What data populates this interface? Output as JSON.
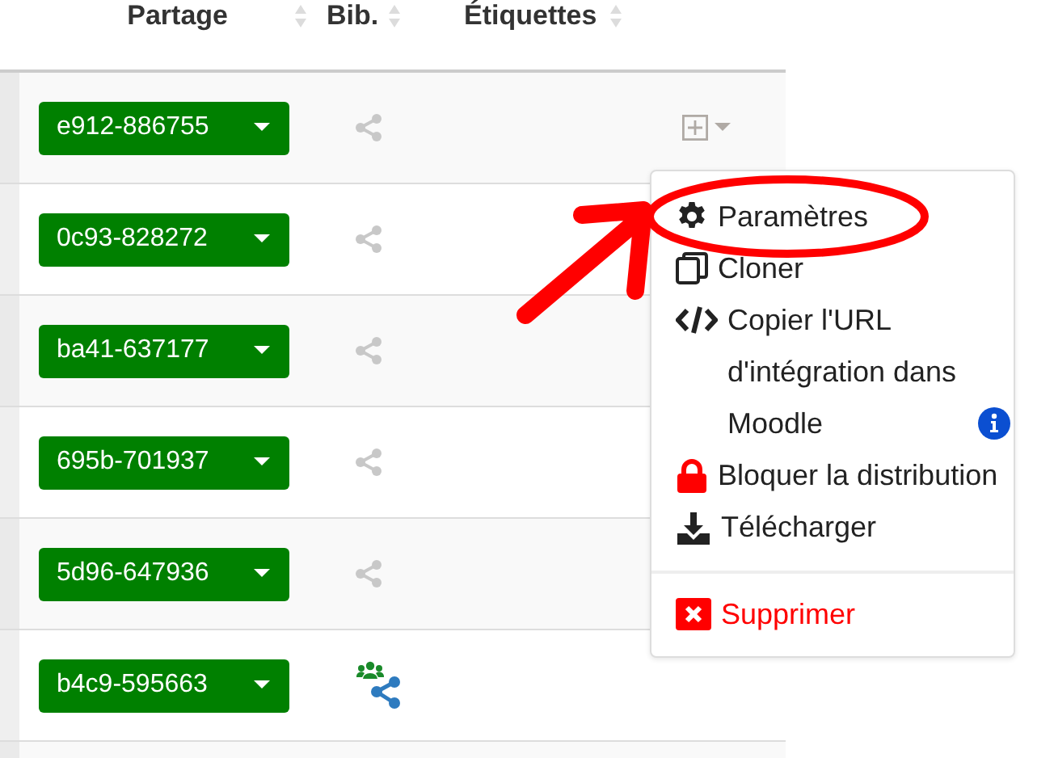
{
  "table": {
    "columns": [
      {
        "label": "Partage"
      },
      {
        "label": "Bib."
      },
      {
        "label": "Étiquettes"
      }
    ],
    "rows": [
      {
        "code": "e912-886755",
        "shared": false,
        "tag_menu": true
      },
      {
        "code": "0c93-828272",
        "shared": false,
        "tag_menu": false
      },
      {
        "code": "ba41-637177",
        "shared": false,
        "tag_menu": false
      },
      {
        "code": "695b-701937",
        "shared": false,
        "tag_menu": false
      },
      {
        "code": "5d96-647936",
        "shared": false,
        "tag_menu": false
      },
      {
        "code": "b4c9-595663",
        "shared": true,
        "tag_menu": false
      }
    ]
  },
  "menu": {
    "items": [
      {
        "kind": "gear",
        "label": "Paramètres",
        "info": false
      },
      {
        "kind": "copy",
        "label": "Cloner",
        "info": false
      },
      {
        "kind": "code",
        "label": "Copier l'URL d'intégration dans Moodle",
        "info": true
      },
      {
        "kind": "lock",
        "label": "Bloquer la distribution",
        "info": false
      },
      {
        "kind": "download",
        "label": "Télécharger",
        "info": false
      }
    ],
    "danger_items": [
      {
        "kind": "times",
        "label": "Supprimer"
      }
    ]
  }
}
